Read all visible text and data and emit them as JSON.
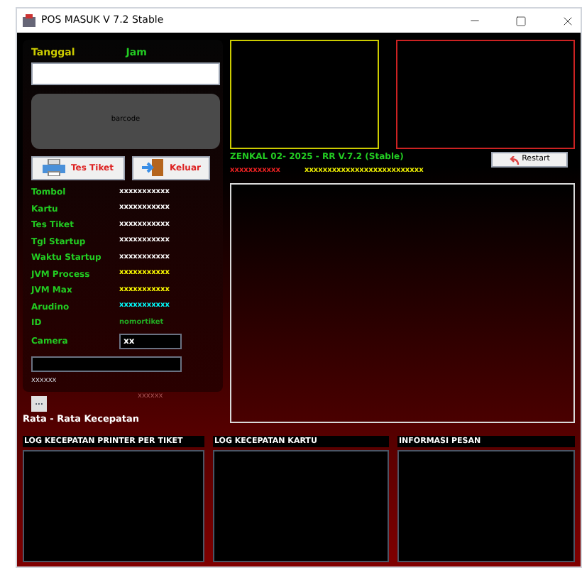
{
  "window": {
    "title": "POS MASUK V 7.2 Stable"
  },
  "header_labels": [
    "Tanggal",
    "Jam"
  ],
  "barcode_button": "barcode",
  "buttons": [
    {
      "label": "Tes Tiket",
      "kind": "printer"
    },
    {
      "label": "Keluar",
      "kind": "exit"
    }
  ],
  "info_rows": [
    {
      "label": "Tombol",
      "value": "xxxxxxxxxxx",
      "color": "#ffffff"
    },
    {
      "label": "Kartu",
      "value": "xxxxxxxxxxx",
      "color": "#ffffff"
    },
    {
      "label": "Tes Tiket",
      "value": "xxxxxxxxxxx",
      "color": "#ffffff"
    },
    {
      "label": "Tgl Startup",
      "value": "xxxxxxxxxxx",
      "color": "#ffffff"
    },
    {
      "label": "Waktu Startup",
      "value": "xxxxxxxxxxx",
      "color": "#ffffff"
    },
    {
      "label": "JVM Process",
      "value": "xxxxxxxxxxx",
      "color": "#ffff00"
    },
    {
      "label": "JVM Max",
      "value": "xxxxxxxxxxx",
      "color": "#ffff00"
    },
    {
      "label": "Arudino",
      "value": "xxxxxxxxxxx",
      "color": "#00ffff"
    },
    {
      "label": "ID",
      "value": "nomortiket",
      "color": "#22aa22"
    }
  ],
  "camera": {
    "label": "Camera",
    "value": "xx"
  },
  "panel_note": "xxxxxx",
  "below_note": "xxxxxx",
  "more_button": "...",
  "average_label": "Rata - Rata Kecepatan",
  "version_text": "ZENKAL 02- 2025 - RR V.7.2 (Stable)",
  "status_red": "xxxxxxxxxxx",
  "status_yellow": "xxxxxxxxxxxxxxxxxxxxxxxxxx",
  "restart_button": "Restart",
  "logs": [
    {
      "title": "LOG KECEPATAN PRINTER PER TIKET"
    },
    {
      "title": "LOG KECEPATAN KARTU"
    },
    {
      "title": "INFORMASI PESAN"
    }
  ]
}
